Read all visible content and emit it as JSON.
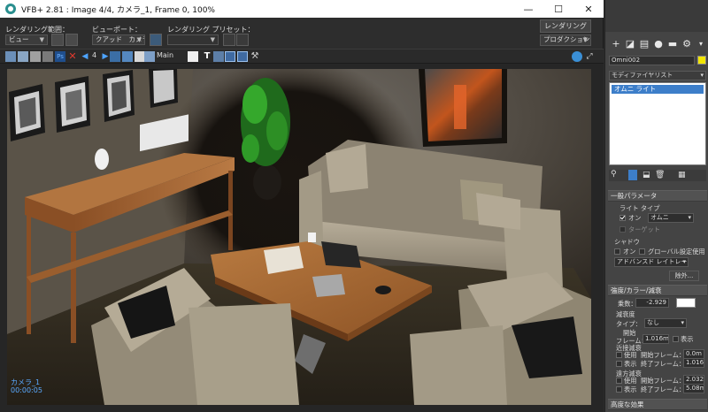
{
  "window": {
    "title": "VFB+ 2.81 : Image 4/4, カメラ_1, Frame 0, 100%",
    "controls": [
      "—",
      "☐",
      "✕"
    ]
  },
  "options": {
    "render_area_label": "レンダリング範囲：",
    "render_area_value": "ビュー",
    "viewport_label": "ビューポート：",
    "viewport_value": "クアッド　カメラ_1",
    "preset_label": "レンダリング プリセット：",
    "preset_value": "",
    "render_button": "レンダリング",
    "production_value": "プロダクション"
  },
  "toolbar": {
    "frame_number": "4",
    "channel": "Main"
  },
  "viewport_overlay": {
    "camera": "カメラ_1",
    "time": "00:00:05"
  },
  "panel": {
    "object_name": "Omni002",
    "object_color": "#f2e600",
    "modifier_list": "モディファイヤリスト",
    "stack_item": "オムニ ライト",
    "general_params": "一般パラメータ",
    "light_type_label": "ライト タイプ",
    "light_on_label": "オン",
    "light_type_value": "オムニ",
    "target_label": "ターゲット",
    "shadow_label": "シャドウ",
    "shadow_on_label": "オン",
    "global_label": "グローバル設定使用",
    "shadow_type_value": "アドバンスド レイトレース",
    "exclude_button": "除外...",
    "intensity_section": "強度/カラー/減衰",
    "multiplier_label": "乗数：",
    "multiplier_value": "-2.929",
    "light_color": "#ffffff",
    "decay_label": "減衰度",
    "decay_type_label": "タイプ：",
    "decay_type_value": "なし",
    "start_label": "開始",
    "start_sub": "フレーム：",
    "start_value": "1.016m",
    "show_label": "表示",
    "near_label": "近接減衰",
    "near_use": "使用",
    "near_start_label": "開始フレーム：",
    "near_start_value": "0.0m",
    "near_show": "表示",
    "near_end_label": "終了フレーム：",
    "near_end_value": "1.016",
    "far_label": "遠方減衰",
    "far_use": "使用",
    "far_start_label": "開始フレーム：",
    "far_start_value": "2.032i",
    "far_show": "表示",
    "far_end_label": "終了フレーム：",
    "far_end_value": "5.08m",
    "advanced_effects": "高度な効果"
  }
}
